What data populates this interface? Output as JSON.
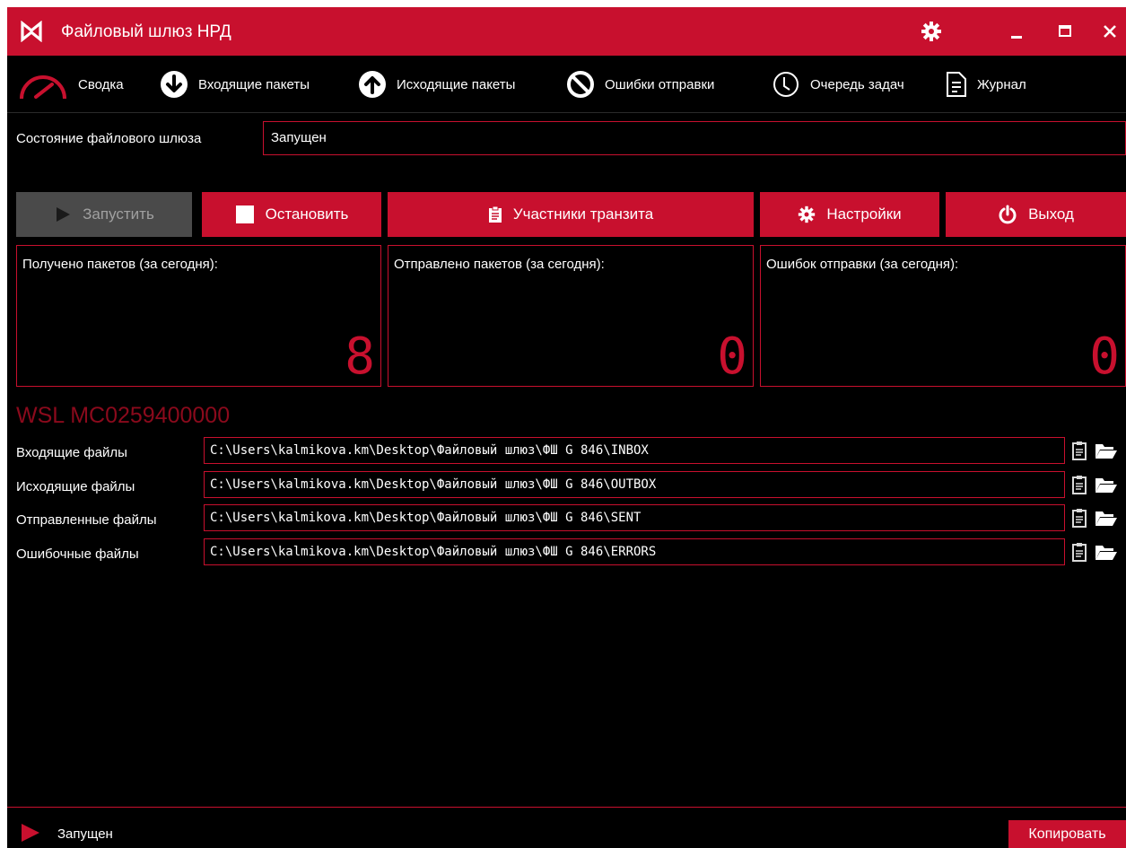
{
  "colors": {
    "accent": "#c8102e",
    "background": "#000000",
    "section_title": "#8b0a1c",
    "disabled": "#4a4a4a"
  },
  "titlebar": {
    "logo_icon": "nrd-logo-icon",
    "title": "Файловый шлюз НРД",
    "controls": [
      "gear-icon",
      "minimize-icon",
      "maximize-icon",
      "close-icon"
    ]
  },
  "tabs": [
    {
      "label": "Сводка",
      "icon": "speedometer-icon"
    },
    {
      "label": "Входящие пакеты",
      "icon": "arrow-down-circle-icon"
    },
    {
      "label": "Исходящие пакеты",
      "icon": "arrow-up-circle-icon"
    },
    {
      "label": "Ошибки отправки",
      "icon": "no-entry-icon"
    },
    {
      "label": "Очередь задач",
      "icon": "clock-icon"
    },
    {
      "label": "Журнал",
      "icon": "document-icon"
    }
  ],
  "gateway_status": {
    "label": "Состояние файлового шлюза",
    "value": "Запущен"
  },
  "buttons": {
    "start": "Запустить",
    "stop": "Остановить",
    "transit": "Участники транзита",
    "settings": "Настройки",
    "exit": "Выход"
  },
  "counters": [
    {
      "label": "Получено пакетов (за сегодня):",
      "value": "8"
    },
    {
      "label": "Отправлено пакетов (за сегодня):",
      "value": "0"
    },
    {
      "label": "Ошибок отправки (за сегодня):",
      "value": "0"
    }
  ],
  "wsl": {
    "title": "WSL MC0259400000",
    "paths": [
      {
        "label": "Входящие файлы",
        "value": "C:\\Users\\kalmikova.km\\Desktop\\Файловый шлюз\\ФШ G 846\\INBOX"
      },
      {
        "label": "Исходящие файлы",
        "value": "C:\\Users\\kalmikova.km\\Desktop\\Файловый шлюз\\ФШ G 846\\OUTBOX"
      },
      {
        "label": "Отправленные файлы",
        "value": "C:\\Users\\kalmikova.km\\Desktop\\Файловый шлюз\\ФШ G 846\\SENT"
      },
      {
        "label": "Ошибочные файлы",
        "value": "C:\\Users\\kalmikova.km\\Desktop\\Файловый шлюз\\ФШ G 846\\ERRORS"
      }
    ]
  },
  "status_bar": {
    "status": "Запущен",
    "copy_button": "Копировать"
  }
}
